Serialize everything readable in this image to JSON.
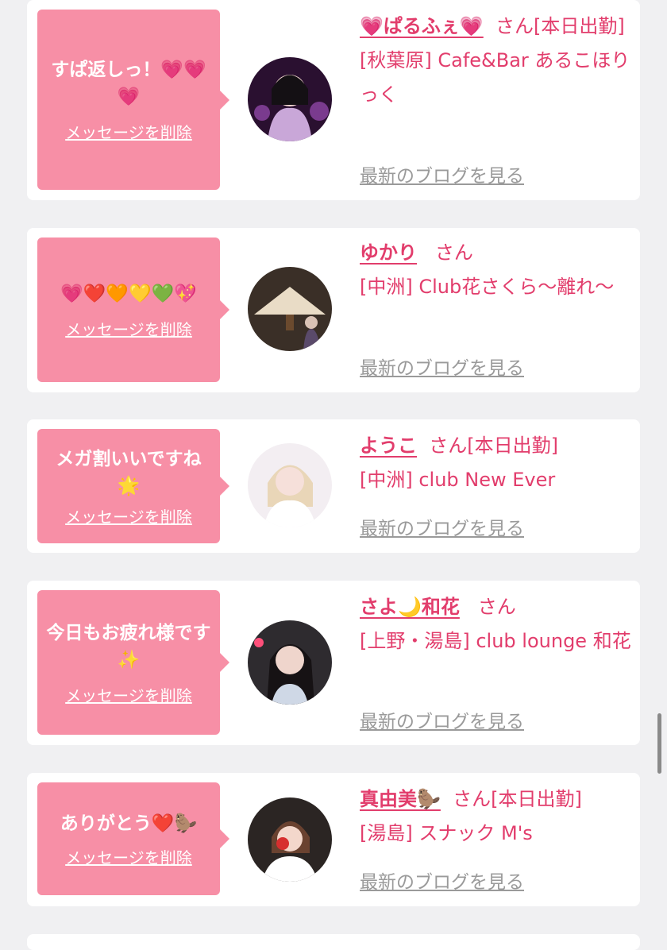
{
  "delete_label": "メッセージを削除",
  "blog_label": "最新のブログを見る",
  "san_suffix": "さん",
  "colors": {
    "accent": "#e23d6c",
    "bubble": "#f78fa6",
    "card": "#ffffff",
    "background": "#f0f0f2"
  },
  "cards": [
    {
      "message": "すぱ返しっ！💗💗💗",
      "name": "💗ぱるふぇ💗",
      "suffix": "[本日出勤]",
      "shop": "[秋葉原] Cafe&Bar あるこほりっく"
    },
    {
      "message": "💗❤️🧡💛💚💖",
      "name": "ゆかり",
      "suffix": "",
      "shop": "[中洲] Club花さくら〜離れ〜"
    },
    {
      "message": "メガ割いいですね🌟",
      "name": "ようこ",
      "suffix": "[本日出勤]",
      "shop": "[中洲] club New Ever"
    },
    {
      "message": "今日もお疲れ様です✨",
      "name": "さよ🌙和花",
      "suffix": "",
      "shop": "[上野・湯島] club lounge 和花"
    },
    {
      "message": "ありがとう❤️🦫",
      "name": "真由美🦫",
      "suffix": "[本日出勤]",
      "shop": "[湯島] スナック M's"
    }
  ]
}
